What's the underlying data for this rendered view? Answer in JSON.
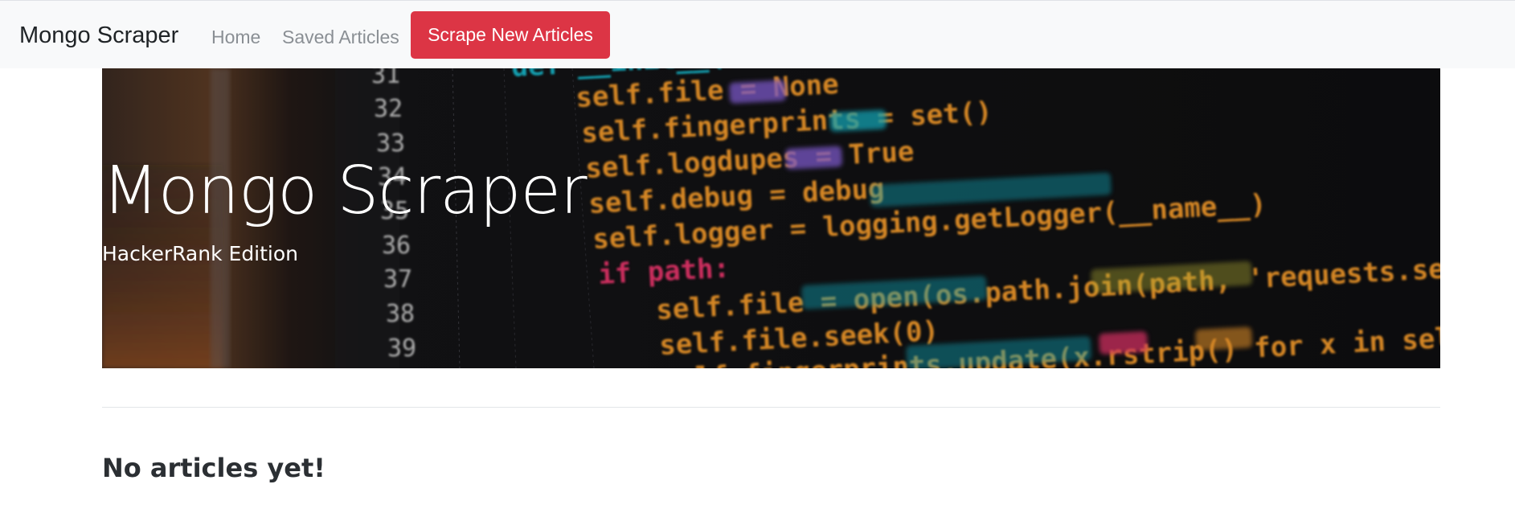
{
  "navbar": {
    "brand": "Mongo Scraper",
    "links": [
      {
        "label": "Home"
      },
      {
        "label": "Saved Articles"
      }
    ],
    "scrape_button": "Scrape New Articles"
  },
  "hero": {
    "title": "Mongo Scraper",
    "subtitle": "HackerRank Edition",
    "background": {
      "line_numbers": [
        "31",
        "32",
        "33",
        "34",
        "35",
        "36",
        "37",
        "38",
        "39"
      ],
      "code_lines": [
        "def __init__(self, path=None",
        "self.file = None",
        "self.fingerprints = set()",
        "self.logdupes = True",
        "self.debug = debug",
        "self.logger = logging.getLogger(__name__)",
        "if path:",
        "self.file = open(os.path.join(path, 'requests.seen'),",
        "self.file.seek(0)",
        "self.fingerprints.update(x.rstrip() for x in self.file)"
      ]
    }
  },
  "content": {
    "empty_message": "No articles yet!"
  },
  "colors": {
    "navbar_bg": "#f8f9fa",
    "button_danger": "#dc3545",
    "code_orange": "#f39a2b",
    "code_pink": "#e8346c",
    "code_purple": "#8a63e0",
    "code_cyan": "#19b6c9",
    "code_yellow": "#c9c23a"
  }
}
